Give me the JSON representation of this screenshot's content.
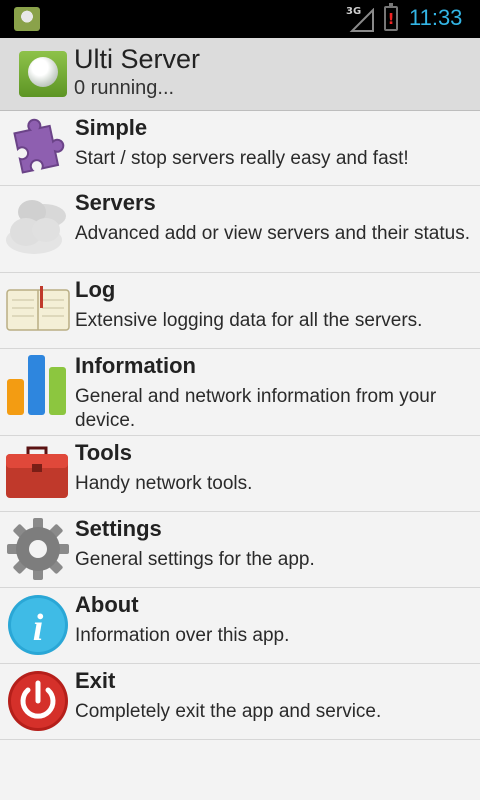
{
  "status_bar": {
    "network_label": "3G",
    "battery_alert": "!",
    "time": "11:33",
    "time_color": "#33b5e5"
  },
  "header": {
    "title": "Ulti Server",
    "subtitle": "0 running..."
  },
  "menu": [
    {
      "title": "Simple",
      "description": "Start / stop servers really easy and fast!",
      "icon": "puzzle-icon"
    },
    {
      "title": "Servers",
      "description": "Advanced add or view servers and their status.",
      "icon": "clouds-icon"
    },
    {
      "title": "Log",
      "description": "Extensive logging data for all the servers.",
      "icon": "notebook-icon"
    },
    {
      "title": "Information",
      "description": "General and network information from your device.",
      "icon": "bar-chart-icon"
    },
    {
      "title": "Tools",
      "description": "Handy network tools.",
      "icon": "toolbox-icon"
    },
    {
      "title": "Settings",
      "description": "General settings for the app.",
      "icon": "gear-icon"
    },
    {
      "title": "About",
      "description": "Information over this app.",
      "icon": "info-icon"
    },
    {
      "title": "Exit",
      "description": "Completely exit the app and service.",
      "icon": "power-icon"
    }
  ]
}
